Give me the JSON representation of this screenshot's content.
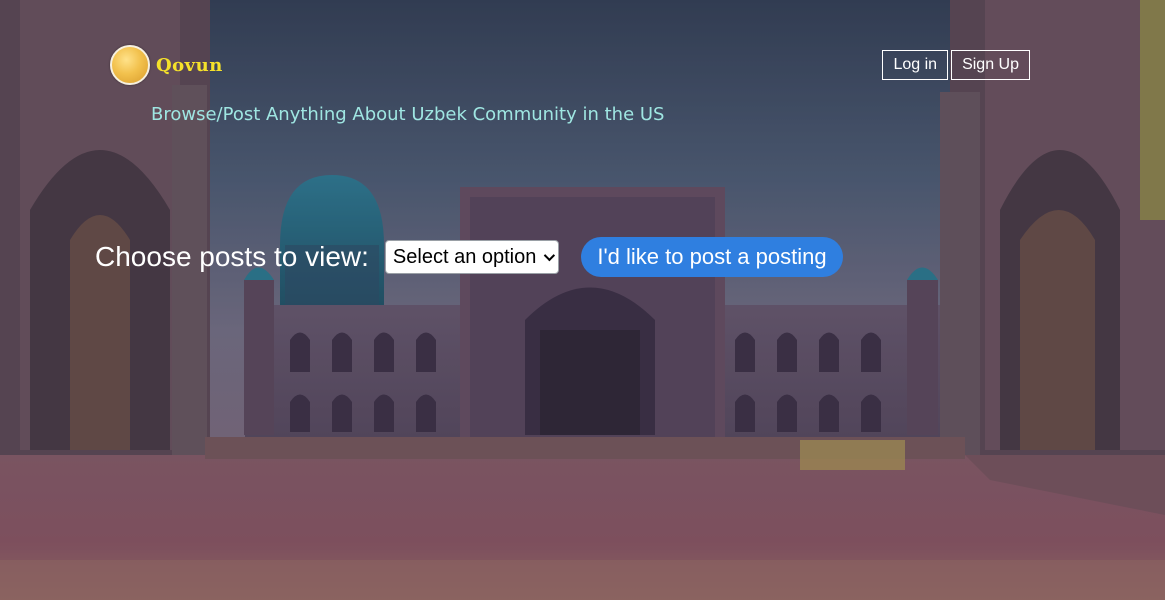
{
  "header": {
    "brand": "Qovun",
    "tagline": "Browse/Post Anything About Uzbek Community in the US",
    "login_label": "Log in",
    "signup_label": "Sign Up"
  },
  "main": {
    "choose_label": "Choose posts to view:",
    "select_value": "Select an option",
    "post_button_label": "I'd like to post a posting"
  },
  "colors": {
    "brand": "#f5e12a",
    "tagline": "#9fe6e2",
    "primary_button": "#2f7fe0"
  },
  "icons": {
    "logo": "moon-logo-icon",
    "select_caret": "chevron-down-icon"
  }
}
